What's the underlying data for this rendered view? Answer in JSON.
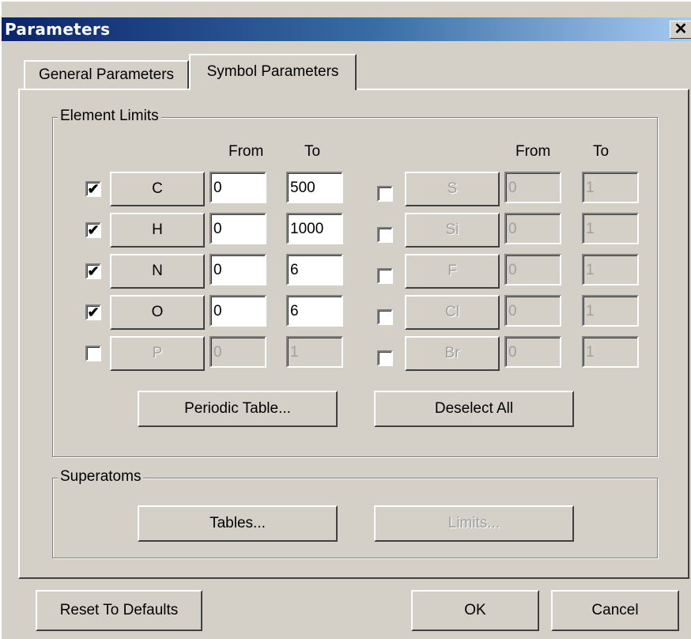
{
  "window": {
    "title": "Parameters",
    "close_glyph": "✕"
  },
  "tabs": [
    {
      "label": "General Parameters",
      "active": false
    },
    {
      "label": "Symbol Parameters",
      "active": true
    }
  ],
  "element_limits": {
    "legend": "Element Limits",
    "col_from": "From",
    "col_to": "To",
    "check_glyph": "✔",
    "left": [
      {
        "symbol": "C",
        "checked": true,
        "from": "0",
        "to": "500"
      },
      {
        "symbol": "H",
        "checked": true,
        "from": "0",
        "to": "1000"
      },
      {
        "symbol": "N",
        "checked": true,
        "from": "0",
        "to": "6"
      },
      {
        "symbol": "O",
        "checked": true,
        "from": "0",
        "to": "6"
      },
      {
        "symbol": "P",
        "checked": false,
        "from": "0",
        "to": "1"
      }
    ],
    "right": [
      {
        "symbol": "S",
        "checked": false,
        "from": "0",
        "to": "1"
      },
      {
        "symbol": "Si",
        "checked": false,
        "from": "0",
        "to": "1"
      },
      {
        "symbol": "F",
        "checked": false,
        "from": "0",
        "to": "1"
      },
      {
        "symbol": "Cl",
        "checked": false,
        "from": "0",
        "to": "1"
      },
      {
        "symbol": "Br",
        "checked": false,
        "from": "0",
        "to": "1"
      }
    ],
    "periodic_table_label": "Periodic Table...",
    "deselect_all_label": "Deselect All"
  },
  "superatoms": {
    "legend": "Superatoms",
    "tables_label": "Tables...",
    "limits_label": "Limits...",
    "limits_enabled": false
  },
  "footer": {
    "reset_label": "Reset To Defaults",
    "ok_label": "OK",
    "cancel_label": "Cancel"
  }
}
